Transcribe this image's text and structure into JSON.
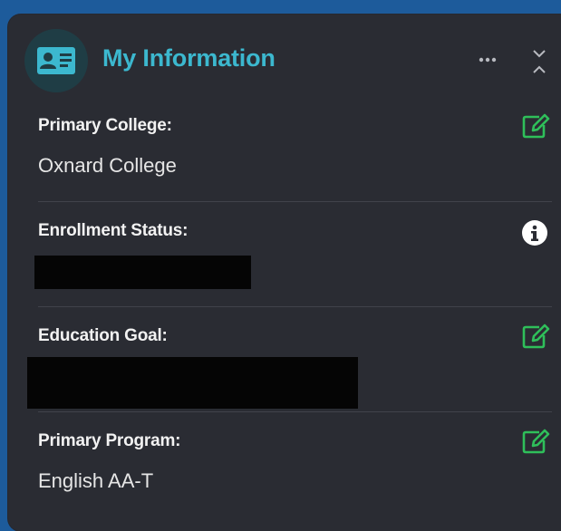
{
  "card": {
    "title": "My Information",
    "icons": {
      "header": "id-card-icon",
      "more": "more-icon",
      "collapse": "collapse-icon",
      "edit": "edit-icon",
      "info": "info-icon"
    },
    "colors": {
      "accent": "#3cb8cf",
      "edit": "#2fbf5a",
      "background": "#2a2c33",
      "page": "#1d5b9b"
    }
  },
  "fields": {
    "primary_college": {
      "label": "Primary College:",
      "value": "Oxnard College"
    },
    "enrollment_status": {
      "label": "Enrollment Status:"
    },
    "education_goal": {
      "label": "Education Goal:"
    },
    "primary_program": {
      "label": "Primary Program:",
      "value": "English AA-T"
    }
  }
}
